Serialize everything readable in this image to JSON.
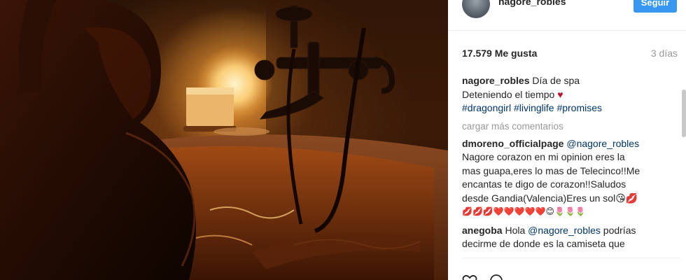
{
  "post": {
    "username": "nagore_robles",
    "follow_label": "Seguir",
    "likes": "17.579 Me gusta",
    "date": "3 días",
    "caption_line1": "Día de spa",
    "caption_line2": "Deteniendo el tiempo",
    "hashtags": [
      "#dragongirl",
      "#livinglife",
      "#promises"
    ],
    "load_more": "cargar más comentarios"
  },
  "comments": [
    {
      "user": "dmoreno_officialpage",
      "mention": "@nagore_robles",
      "lines": [
        "Nagore corazon en mi opinion eres la",
        "mas guapa,eres lo mas de Telecinco!!Me",
        "encantas te digo de corazon!!Saludos",
        "desde Gandia(Valencia)Eres un sol"
      ],
      "emoji_tail": "😘💋",
      "emoji_line": "💋💋💋❤️❤️❤️❤️❤️😊🌷🌷🌷"
    },
    {
      "user": "anegoba",
      "greeting": "Hola",
      "mention": "@nagore_robles",
      "after_mention": "podrías",
      "lines": [
        "decirme de donde es la camiseta que"
      ]
    }
  ],
  "icons": [
    "like-heart-icon",
    "comment-bubble-icon",
    "tap-arrow-icon"
  ],
  "colors": {
    "accent": "#3897f0",
    "hashtag": "#003569",
    "muted": "#999999",
    "heart": "#c01230"
  }
}
